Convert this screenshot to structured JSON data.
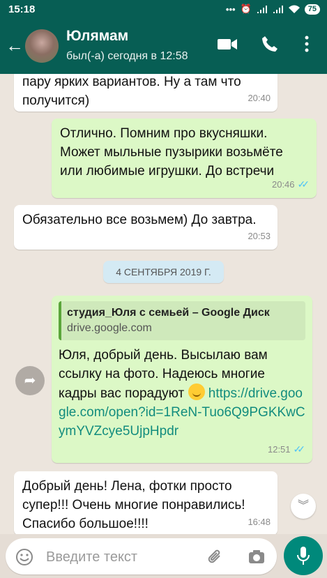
{
  "status_bar": {
    "time": "15:18",
    "signal_text": "•••",
    "battery": "75"
  },
  "header": {
    "contact_name": "Юлямам",
    "last_seen": "был(-а) сегодня в 12:58"
  },
  "messages": [
    {
      "direction": "incoming",
      "text": "пару ярких вариантов. Ну а там что получится)",
      "time": "20:40"
    },
    {
      "direction": "outgoing",
      "text": "Отлично. Помним про вкусняшки. Может мыльные пузырики возьмёте или любимые игрушки. До встречи",
      "time": "20:46",
      "read": true
    },
    {
      "direction": "incoming",
      "text": "Обязательно все возьмем) До завтра.",
      "time": "20:53"
    }
  ],
  "date_divider": "4 СЕНТЯБРЯ 2019 Г.",
  "link_message": {
    "preview_title": "студия_Юля с семьей – Google Диск",
    "preview_domain": "drive.google.com",
    "text": "Юля, добрый день. Высылаю вам ссылку на фото. Надеюсь многие кадры вас порадуют",
    "emoji": "hugging-face",
    "link": "https://drive.google.com/open?id=1ReN-Tuo6Q9PGKKwCymYVZcye5UjpHpdr",
    "time": "12:51",
    "read": true
  },
  "last_message": {
    "text": "Добрый день! Лена, фотки просто супер!!! Очень многие понравились! Спасибо большое!!!!",
    "time": "16:48"
  },
  "composer": {
    "placeholder": "Введите текст"
  },
  "colors": {
    "header": "#075e54",
    "outgoing_bubble": "#dcf8c6",
    "incoming_bubble": "#ffffff",
    "read_ticks": "#4fc3f7",
    "mic_button": "#00897b"
  }
}
